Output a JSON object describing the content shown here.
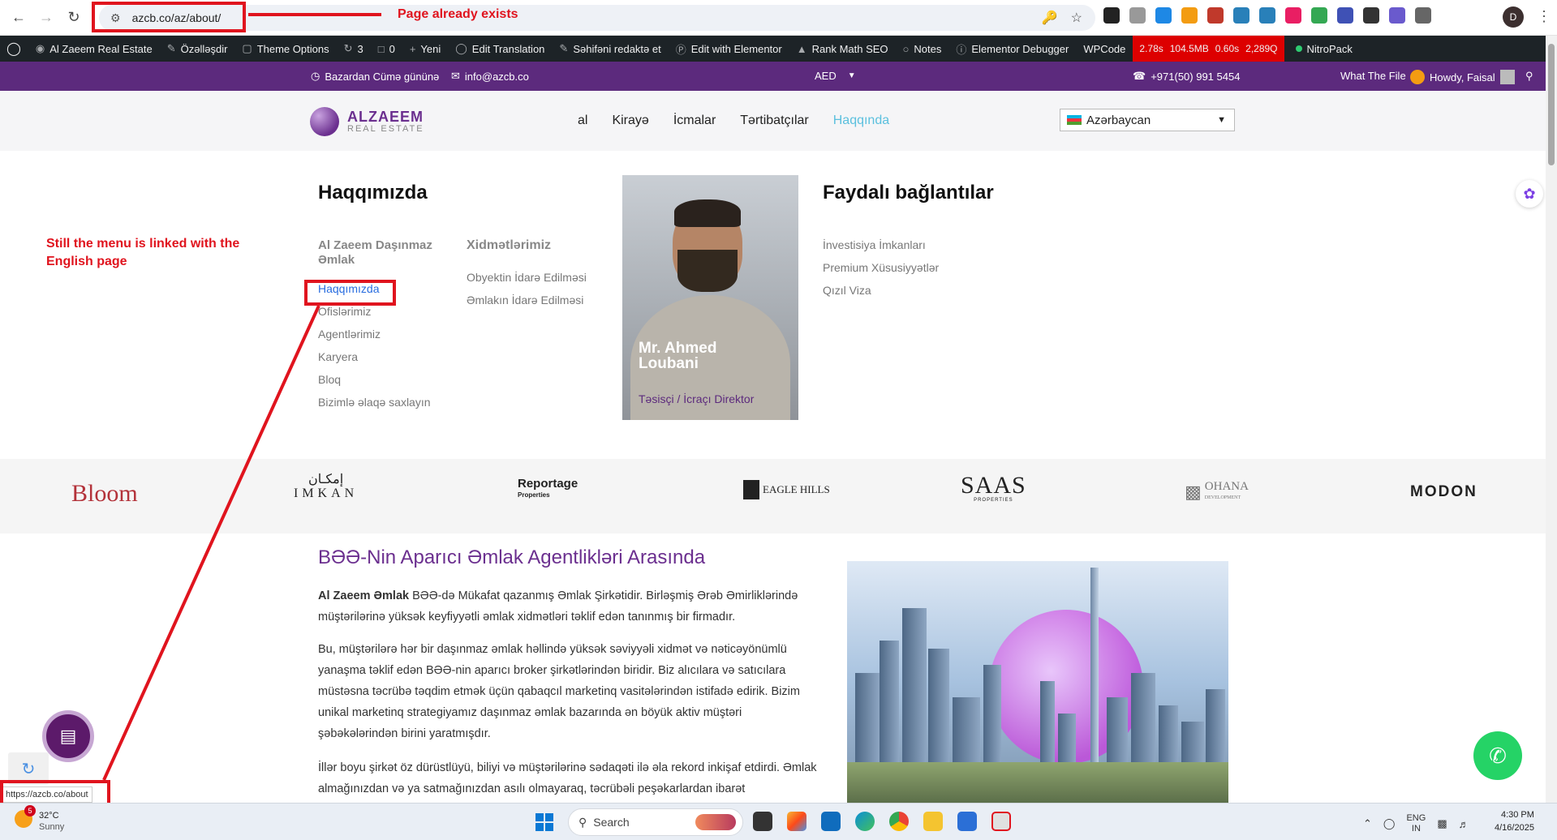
{
  "browser": {
    "url": "azcb.co/az/about/",
    "extensions": [
      {
        "icon": "ext-square-icon",
        "color": "#222"
      },
      {
        "icon": "ext-link-icon",
        "color": "#999"
      },
      {
        "icon": "ext-m-icon",
        "color": "#1e88e5"
      },
      {
        "icon": "ext-amazon-icon",
        "color": "#f39c12"
      },
      {
        "icon": "ext-doc-icon",
        "color": "#c0392b"
      },
      {
        "icon": "ext-tag-icon",
        "color": "#2980b9"
      },
      {
        "icon": "ext-tag2-icon",
        "color": "#2980b9"
      },
      {
        "icon": "ext-new-icon",
        "color": "#e91e63"
      },
      {
        "icon": "ext-chrome-icon",
        "color": "#34a853"
      },
      {
        "icon": "ext-a-icon",
        "color": "#3f51b5"
      },
      {
        "icon": "ext-fx-icon",
        "color": "#333"
      },
      {
        "icon": "ext-sun-icon",
        "color": "#6a5acd"
      },
      {
        "icon": "ext-puzzle-icon",
        "color": "#666"
      }
    ],
    "profile_initial": "D",
    "status_url": "https://azcb.co/about"
  },
  "wp_admin_bar": {
    "site_name": "Al Zaeem Real Estate",
    "customize": "Özəlləşdir",
    "theme_options": "Theme Options",
    "updates_count": "3",
    "comments_count": "0",
    "new": "Yeni",
    "edit_translation": "Edit Translation",
    "edit_page": "Səhifəni redaktə et",
    "elementor": "Edit with Elementor",
    "rank_math": "Rank Math SEO",
    "notes": "Notes",
    "debugger": "Elementor Debugger",
    "wpcode": "WPCode",
    "perf": [
      "2.78s",
      "104.5MB",
      "0.60s",
      "2,289Q"
    ],
    "nitropack": "NitroPack"
  },
  "topbar": {
    "hours": "Bazardan Cümə gününə",
    "email": "info@azcb.co",
    "currency": "AED",
    "phone": "+971(50) 991 5454",
    "what_the_file": "What The File",
    "howdy": "Howdy, Faisal"
  },
  "header": {
    "logo_name": "ALZAEEM",
    "logo_sub": "REAL ESTATE",
    "nav": [
      "al",
      "Kirayə",
      "İcmalar",
      "Tərtibatçılar",
      "Haqqında"
    ],
    "language": "Azərbaycan"
  },
  "mega_menu": {
    "about_heading": "Haqqımızda",
    "company_sub": "Al Zaeem Daşınmaz Əmlak",
    "company_links": [
      "Haqqımızda",
      "Ofislərimiz",
      "Agentlərimiz",
      "Karyera",
      "Bloq",
      "Bizimlə əlaqə saxlayın"
    ],
    "services_sub": "Xidmətlərimiz",
    "service_links": [
      "Obyektin İdarə Edilməsi",
      "Əmlakın İdarə Edilməsi"
    ],
    "director_name": "Mr. Ahmed Loubani",
    "director_role": "Təsisçi / İcraçı Direktor",
    "useful_heading": "Faydalı bağlantılar",
    "useful_links": [
      "İnvestisiya İmkanları",
      "Premium Xüsusiyyətlər",
      "Qızıl Viza"
    ]
  },
  "brands": [
    "Bloom",
    "IMKAN",
    "Reportage",
    "EAGLE HILLS",
    "SAAS",
    "OHANA",
    "MODON"
  ],
  "brand_subs": {
    "imkan": "إمكـان",
    "reportage": "Properties",
    "saas": "PROPERTIES",
    "ohana": "DEVELOPMENT"
  },
  "content": {
    "heading": "BƏƏ-Nin Aparıcı Əmlak Agentlikləri Arasında",
    "p1_bold": "Al Zaeem Əmlak",
    "p1": " BƏƏ-də Mükafat qazanmış Əmlak Şirkətidir. Birləşmiş Ərəb Əmirliklərində müştərilərinə yüksək keyfiyyətli əmlak xidmətləri təklif edən tanınmış bir firmadır.",
    "p2": "Bu, müştərilərə hər bir daşınmaz əmlak həllində yüksək səviyyəli xidmət və nəticəyönümlü yanaşma təklif edən BƏƏ-nin aparıcı broker şirkətlərindən biridir. Biz alıcılara və satıcılara müstəsna təcrübə təqdim etmək üçün qabaqcıl marketinq vasitələrindən istifadə edirik. Bizim unikal marketinq strategiyamız daşınmaz əmlak bazarında ən böyük aktiv müştəri şəbəkələrindən birini yaratmışdır.",
    "p3": "İllər boyu şirkət öz dürüstlüyü, biliyi və müştərilərinə sədaqəti ilə əla rekord inkişaf etdirdi. Əmlak almağınızdan və ya satmağınızdan asılı olmayaraq, təcrübəli peşəkarlardan ibarət"
  },
  "annotations": {
    "page_exists": "Page already exists",
    "menu_linked": "Still the menu is linked with the English page"
  },
  "taskbar": {
    "temp": "32°C",
    "weather": "Sunny",
    "badge": "5",
    "search": "Search",
    "lang1": "ENG",
    "lang2": "IN",
    "time": "4:30 PM",
    "date": "4/16/2025"
  },
  "colors": {
    "accent": "#5c2a7d",
    "annotation": "#e0141e",
    "active_nav": "#5bc0de"
  }
}
